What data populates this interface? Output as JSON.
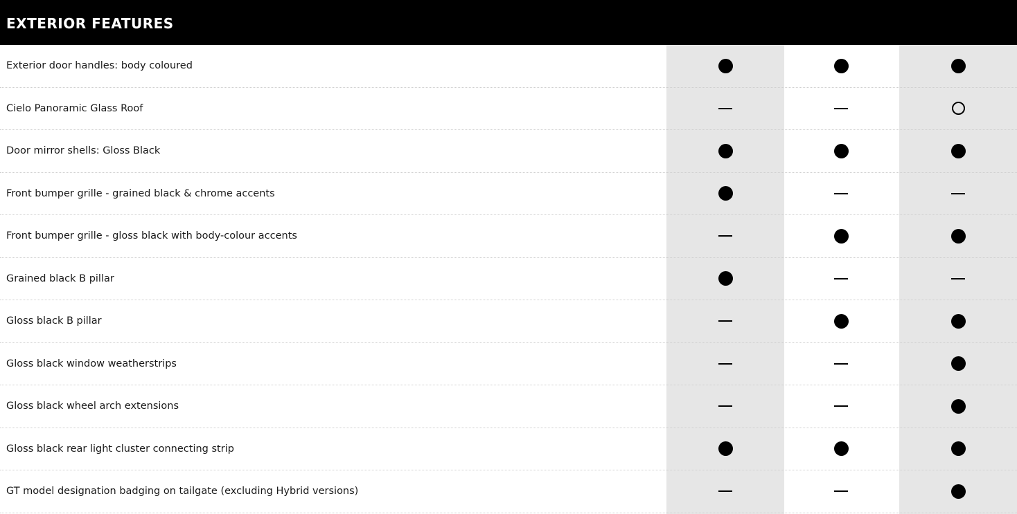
{
  "header": {
    "title": "EXTERIOR FEATURES"
  },
  "legend": {
    "standard": "dot-filled",
    "optional": "dot-open",
    "not_available": "dash"
  },
  "rows": [
    {
      "label": "Exterior door handles: body coloured",
      "values": [
        "standard",
        "standard",
        "standard"
      ]
    },
    {
      "label": "Cielo Panoramic Glass Roof",
      "values": [
        "not_available",
        "not_available",
        "optional"
      ]
    },
    {
      "label": "Door mirror shells: Gloss Black",
      "values": [
        "standard",
        "standard",
        "standard"
      ]
    },
    {
      "label": "Front bumper grille - grained black & chrome accents",
      "values": [
        "standard",
        "not_available",
        "not_available"
      ]
    },
    {
      "label": "Front bumper grille - gloss black with body-colour accents",
      "values": [
        "not_available",
        "standard",
        "standard"
      ]
    },
    {
      "label": "Grained black B pillar",
      "values": [
        "standard",
        "not_available",
        "not_available"
      ]
    },
    {
      "label": "Gloss black B pillar",
      "values": [
        "not_available",
        "standard",
        "standard"
      ]
    },
    {
      "label": "Gloss black window weatherstrips",
      "values": [
        "not_available",
        "not_available",
        "standard"
      ]
    },
    {
      "label": "Gloss black wheel arch extensions",
      "values": [
        "not_available",
        "not_available",
        "standard"
      ]
    },
    {
      "label": "Gloss black rear light cluster connecting strip",
      "values": [
        "standard",
        "standard",
        "standard"
      ]
    },
    {
      "label": "GT model designation badging on tailgate (excluding Hybrid versions)",
      "values": [
        "not_available",
        "not_available",
        "standard"
      ]
    }
  ],
  "colors": {
    "header_bg": "#000000",
    "column_shade": "#e6e6e6",
    "marker": "#000000"
  }
}
